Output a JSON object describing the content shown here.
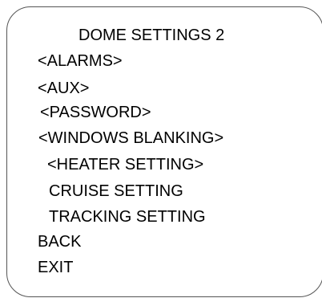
{
  "menu": {
    "title": "DOME SETTINGS 2",
    "items": [
      {
        "label": "<ALARMS>"
      },
      {
        "label": "<AUX>"
      },
      {
        "label": "<PASSWORD>"
      },
      {
        "label": "<WINDOWS BLANKING>"
      },
      {
        "label": "<HEATER SETTING>"
      },
      {
        "label": "CRUISE SETTING"
      },
      {
        "label": "TRACKING SETTING"
      },
      {
        "label": "BACK"
      },
      {
        "label": "EXIT"
      }
    ]
  }
}
